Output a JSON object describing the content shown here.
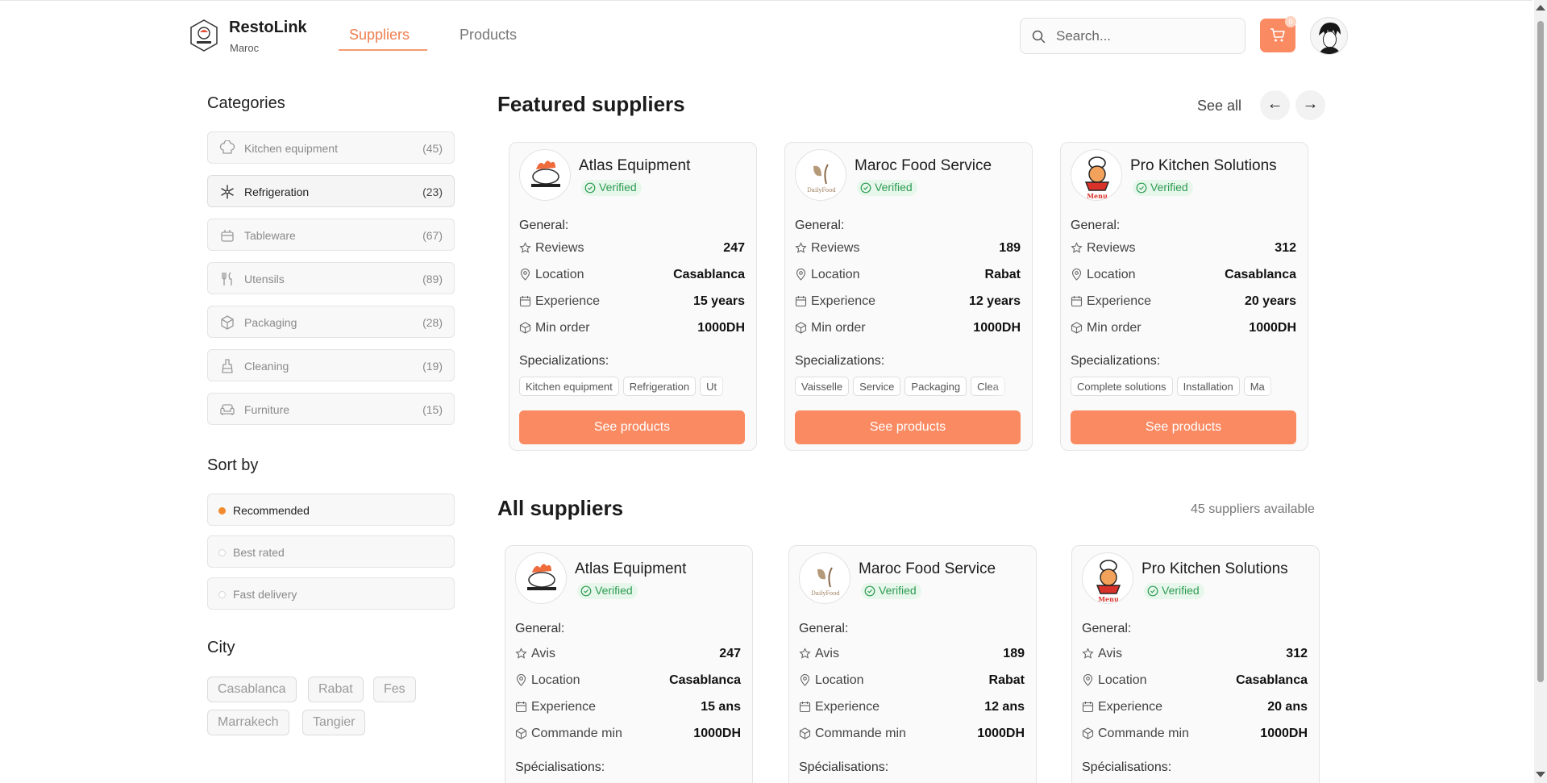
{
  "header": {
    "brand_name": "RestoLink",
    "brand_sub": "Maroc",
    "nav": {
      "suppliers": "Suppliers",
      "products": "Products"
    },
    "search_placeholder": "Search...",
    "cart_count": "0"
  },
  "sidebar": {
    "categories_title": "Categories",
    "categories": [
      {
        "label": "Kitchen equipment",
        "count": "(45)",
        "icon": "chef-hat-icon"
      },
      {
        "label": "Refrigeration",
        "count": "(23)",
        "icon": "snowflake-icon",
        "active": true
      },
      {
        "label": "Tableware",
        "count": "(67)",
        "icon": "tableware-icon"
      },
      {
        "label": "Utensils",
        "count": "(89)",
        "icon": "utensils-icon"
      },
      {
        "label": "Packaging",
        "count": "(28)",
        "icon": "package-icon"
      },
      {
        "label": "Cleaning",
        "count": "(19)",
        "icon": "cleaning-icon"
      },
      {
        "label": "Furniture",
        "count": "(15)",
        "icon": "sofa-icon"
      }
    ],
    "sort_title": "Sort by",
    "sort_options": [
      {
        "label": "Recommended",
        "active": true
      },
      {
        "label": "Best rated"
      },
      {
        "label": "Fast delivery"
      }
    ],
    "city_title": "City",
    "cities": [
      "Casablanca",
      "Rabat",
      "Fes",
      "Marrakech",
      "Tangier"
    ]
  },
  "featured": {
    "title": "Featured suppliers",
    "see_all": "See all",
    "prev": "←",
    "next": "→",
    "cards": [
      {
        "name": "Atlas Equipment",
        "verified": "Verified",
        "general": "General:",
        "rows": [
          {
            "label": "Reviews",
            "value": "247",
            "icon": "star-icon"
          },
          {
            "label": "Location",
            "value": "Casablanca",
            "icon": "map-pin-icon"
          },
          {
            "label": "Experience",
            "value": "15 years",
            "icon": "calendar-icon"
          },
          {
            "label": "Min order",
            "value": "1000DH",
            "icon": "box-icon"
          }
        ],
        "spec_title": "Specializations:",
        "tags": [
          "Kitchen equipment",
          "Refrigeration",
          "Ut"
        ],
        "button": "See products"
      },
      {
        "name": "Maroc Food Service",
        "verified": "Verified",
        "general": "General:",
        "rows": [
          {
            "label": "Reviews",
            "value": "189",
            "icon": "star-icon"
          },
          {
            "label": "Location",
            "value": "Rabat",
            "icon": "map-pin-icon"
          },
          {
            "label": "Experience",
            "value": "12 years",
            "icon": "calendar-icon"
          },
          {
            "label": "Min order",
            "value": "1000DH",
            "icon": "box-icon"
          }
        ],
        "spec_title": "Specializations:",
        "tags": [
          "Vaisselle",
          "Service",
          "Packaging",
          "Clea"
        ],
        "button": "See products"
      },
      {
        "name": "Pro Kitchen Solutions",
        "verified": "Verified",
        "general": "General:",
        "rows": [
          {
            "label": "Reviews",
            "value": "312",
            "icon": "star-icon"
          },
          {
            "label": "Location",
            "value": "Casablanca",
            "icon": "map-pin-icon"
          },
          {
            "label": "Experience",
            "value": "20 years",
            "icon": "calendar-icon"
          },
          {
            "label": "Min order",
            "value": "1000DH",
            "icon": "box-icon"
          }
        ],
        "spec_title": "Specializations:",
        "tags": [
          "Complete solutions",
          "Installation",
          "Ma"
        ],
        "button": "See products"
      }
    ]
  },
  "all": {
    "title": "All suppliers",
    "count_text": "45 suppliers available",
    "cards": [
      {
        "name": "Atlas Equipment",
        "verified": "Verified",
        "general": "General:",
        "rows": [
          {
            "label": "Avis",
            "value": "247",
            "icon": "star-icon"
          },
          {
            "label": "Location",
            "value": "Casablanca",
            "icon": "map-pin-icon"
          },
          {
            "label": "Experience",
            "value": "15 ans",
            "icon": "calendar-icon"
          },
          {
            "label": "Commande min",
            "value": "1000DH",
            "icon": "box-icon"
          }
        ],
        "spec_title": "Spécialisations:"
      },
      {
        "name": "Maroc Food Service",
        "verified": "Verified",
        "general": "General:",
        "rows": [
          {
            "label": "Avis",
            "value": "189",
            "icon": "star-icon"
          },
          {
            "label": "Location",
            "value": "Rabat",
            "icon": "map-pin-icon"
          },
          {
            "label": "Experience",
            "value": "12 ans",
            "icon": "calendar-icon"
          },
          {
            "label": "Commande min",
            "value": "1000DH",
            "icon": "box-icon"
          }
        ],
        "spec_title": "Spécialisations:"
      },
      {
        "name": "Pro Kitchen Solutions",
        "verified": "Verified",
        "general": "General:",
        "rows": [
          {
            "label": "Avis",
            "value": "312",
            "icon": "star-icon"
          },
          {
            "label": "Location",
            "value": "Casablanca",
            "icon": "map-pin-icon"
          },
          {
            "label": "Experience",
            "value": "20 ans",
            "icon": "calendar-icon"
          },
          {
            "label": "Commande min",
            "value": "1000DH",
            "icon": "box-icon"
          }
        ],
        "spec_title": "Spécialisations:"
      }
    ]
  },
  "colors": {
    "accent": "#fa8a62",
    "nav_active": "#f07d4f",
    "verified_bg": "#e8f7ec",
    "verified_text": "#2c9b50",
    "sort_dot": "#f28b2e"
  }
}
